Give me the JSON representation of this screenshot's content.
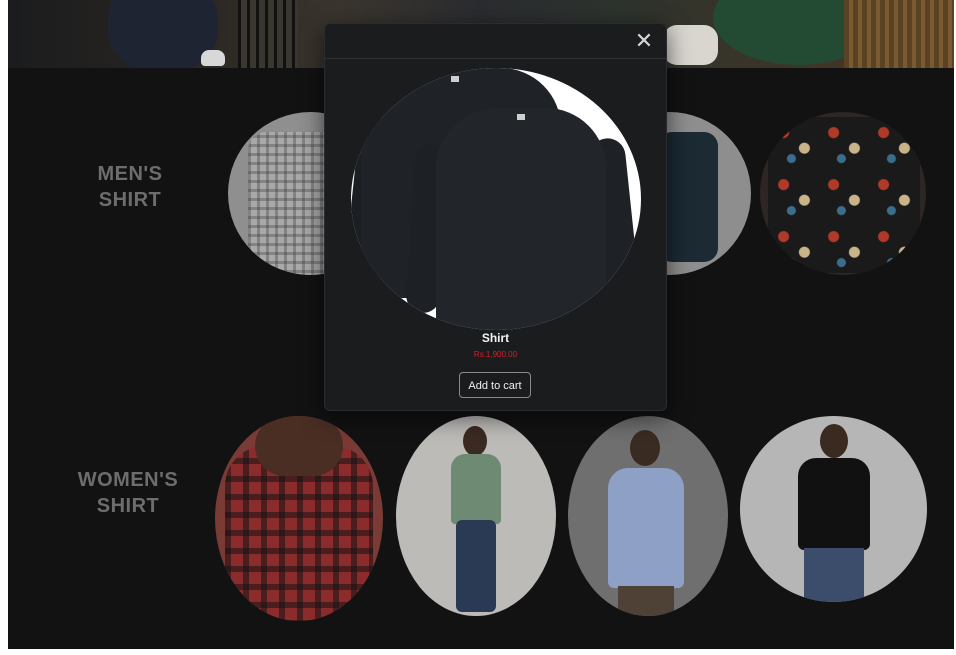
{
  "sections": {
    "men": {
      "label_line1": "MEN'S",
      "label_line2": "SHIRT"
    },
    "women": {
      "label_line1": "WOMEN'S",
      "label_line2": "SHIRT"
    }
  },
  "modal": {
    "close_icon": "close-icon",
    "close_glyph": "✕",
    "product_name": "Shirt",
    "product_price": "Rs.1,900.00",
    "add_to_cart_label": "Add to cart"
  },
  "colors": {
    "background": "#121212",
    "modal_background": "#1b1c1e",
    "price": "#d0202a",
    "section_label": "#6d6d6d"
  }
}
